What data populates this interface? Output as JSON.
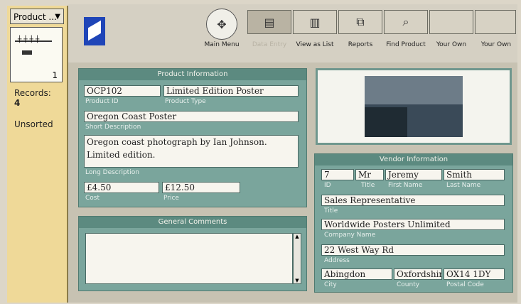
{
  "sidebar": {
    "layout_select": "Product ...",
    "book_page": "1",
    "records_label": "Records:",
    "records_count": "4",
    "sort_status": "Unsorted"
  },
  "toolbar": {
    "main_menu": "Main Menu",
    "data_entry": "Data Entry",
    "view_as_list": "View as List",
    "reports": "Reports",
    "find_product": "Find Product",
    "your_own_1": "Your Own",
    "your_own_2": "Your Own"
  },
  "product": {
    "title": "Product Information",
    "product_id": "OCP102",
    "product_id_label": "Product ID",
    "product_type": "Limited Edition Poster",
    "product_type_label": "Product Type",
    "short_description": "Oregon Coast Poster",
    "short_description_label": "Short Description",
    "long_description": "Oregon coast photograph by Ian Johnson. Limited edition.",
    "long_description_label": "Long Description",
    "cost": "£4.50",
    "cost_label": "Cost",
    "price": "£12.50",
    "price_label": "Price"
  },
  "comments": {
    "title": "General Comments",
    "text": ""
  },
  "vendor": {
    "title": "Vendor Information",
    "id": "7",
    "id_label": "ID",
    "title_prefix": "Mr",
    "title_prefix_label": "Title",
    "first_name": "Jeremy",
    "first_name_label": "First Name",
    "last_name": "Smith",
    "last_name_label": "Last Name",
    "job_title": "Sales Representative",
    "job_title_label": "Title",
    "company": "Worldwide Posters Unlimited",
    "company_label": "Company Name",
    "address": "22 West Way Rd",
    "address_label": "Address",
    "city": "Abingdon",
    "city_label": "City",
    "county": "Oxfordshire",
    "county_label": "County",
    "postcode": "OX14 1DY",
    "postcode_label": "Postal Code"
  }
}
